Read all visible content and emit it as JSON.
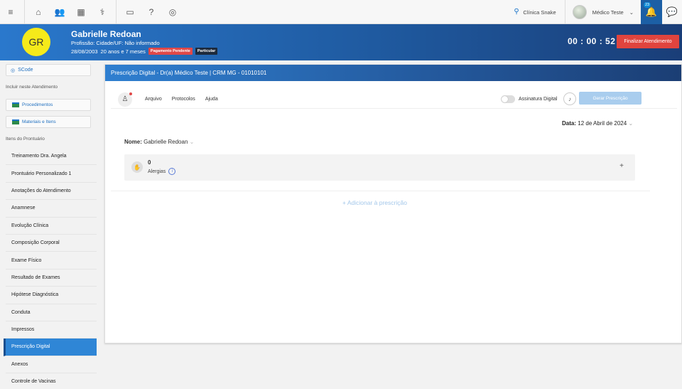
{
  "topbar": {
    "icons": [
      "menu-icon",
      "home-icon",
      "users-icon",
      "calendar-icon",
      "stethoscope-icon",
      "id-card-icon",
      "help-icon",
      "scode-icon"
    ],
    "clinic": "Clínica Snake",
    "user": "Médico Teste",
    "notifications_count": "23"
  },
  "patient": {
    "initials": "GR",
    "name": "Gabrielle Redoan",
    "profession_line": "Profissão: Cidade/UF: Não informado",
    "birth": "28/08/2003",
    "age": "20 anos e 7 meses",
    "tag_payment": "Pagamento Pendente",
    "tag_type": "Particular",
    "timer": "00 : 00 : 52",
    "finish_label": "Finalizar Atendimento"
  },
  "sidebar": {
    "scode_label": "SCode",
    "include_caption": "Incluir neste Atendimento",
    "btn_procedimentos": "Procedimentos",
    "btn_materiais": "Materiais e Itens",
    "record_caption": "Itens do Prontuário",
    "items": [
      "Treinamento Dra. Angela",
      "Prontuário Personalizado 1",
      "Anotações do Atendimento",
      "Anamnese",
      "Evolução Clínica",
      "Composição Corporal",
      "Exame Físico",
      "Resultado de Exames",
      "Hipótese Diagnóstica",
      "Conduta",
      "Impressos",
      "Prescrição Digital",
      "Anexos",
      "Controle de Vacinas"
    ],
    "active_index": 11
  },
  "panel": {
    "title": "Prescrição Digital - Dr(a) Médico Teste | CRM MG - 01010101",
    "menu": [
      "Arquivo",
      "Protocolos",
      "Ajuda"
    ],
    "assinatura_label": "Assinatura Digital",
    "gerar_label": "Gerar Prescrição",
    "date_label": "Data:",
    "date_value": "12 de Abril de 2024",
    "nome_label": "Nome:",
    "nome_value": "Gabrielle Redoan",
    "allergy_count": "0",
    "allergy_label": "Alergias",
    "add_label": "+ Adicionar à prescrição"
  }
}
